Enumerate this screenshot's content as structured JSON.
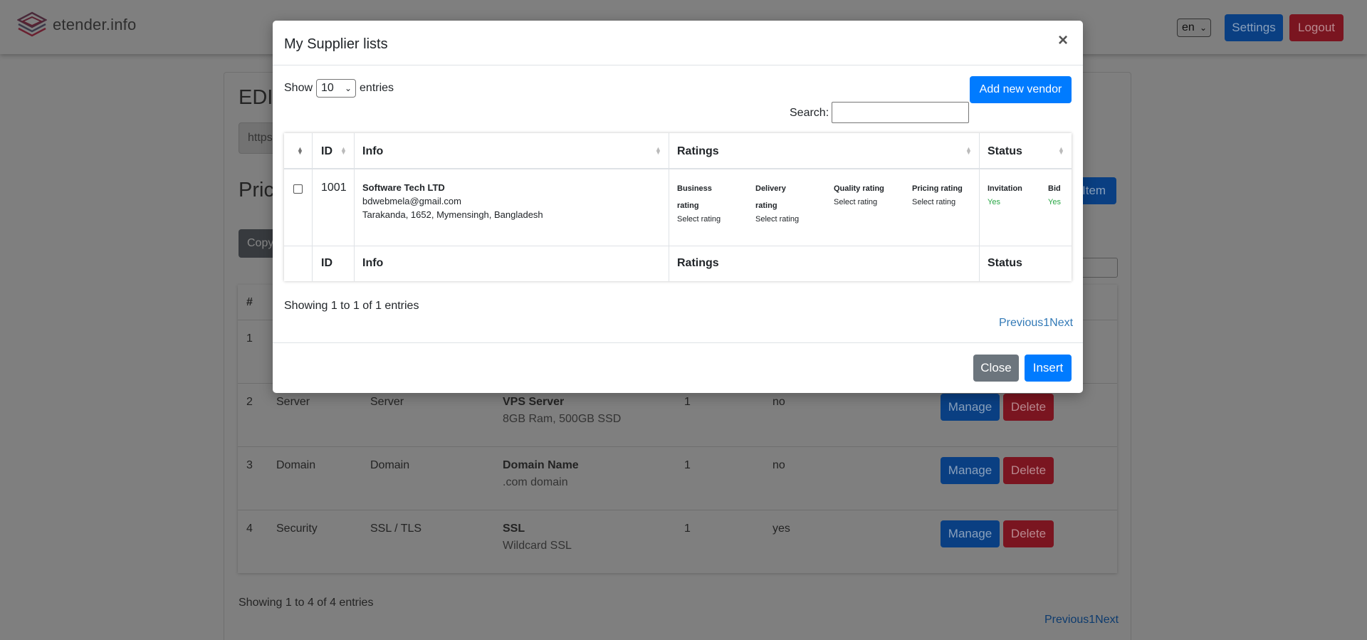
{
  "app": {
    "logo_text": "etender.info",
    "language": "en",
    "settings_label": "Settings",
    "logout_label": "Logout"
  },
  "background": {
    "heading_edit": "EDI",
    "url_prefix": "https",
    "heading_pricing": "Pric",
    "copy_label": "Copy",
    "add_item_label": "Item",
    "table_hash": "#",
    "rows": [
      {
        "num": "1",
        "category": "",
        "type": "",
        "name": "",
        "desc": "",
        "qty": "",
        "flag": ""
      },
      {
        "num": "2",
        "category": "Server",
        "type": "Server",
        "name": "VPS Server",
        "desc": "8GB Ram, 500GB SSD",
        "qty": "1",
        "flag": "no"
      },
      {
        "num": "3",
        "category": "Domain",
        "type": "Domain",
        "name": "Domain Name",
        "desc": ".com domain",
        "qty": "1",
        "flag": "no"
      },
      {
        "num": "4",
        "category": "Security",
        "type": "SSL / TLS",
        "name": "SSL",
        "desc": "Wildcard SSL",
        "qty": "1",
        "flag": "yes"
      }
    ],
    "manage_label": "Manage",
    "delete_label": "Delete",
    "showing_text": "Showing 1 to 4 of 4 entries",
    "pager": {
      "prev": "Previous",
      "page": "1",
      "next": "Next"
    }
  },
  "modal": {
    "title": "My Supplier lists",
    "close_symbol": "×",
    "show_label": "Show",
    "page_length": "10",
    "entries_label": "entries",
    "add_vendor_label": "Add new vendor",
    "search_label": "Search:",
    "search_value": "",
    "columns": {
      "id": "ID",
      "info": "Info",
      "ratings": "Ratings",
      "status": "Status"
    },
    "rows": [
      {
        "id": "1001",
        "name": "Software Tech LTD",
        "email": "bdwebmela@gmail.com",
        "address": "Tarakanda, 1652, Mymensingh, Bangladesh",
        "ratings": [
          {
            "label": "Business rating",
            "value": "Select rating"
          },
          {
            "label": "Delivery rating",
            "value": "Select rating"
          },
          {
            "label": "Quality rating",
            "value": "Select rating"
          },
          {
            "label": "Pricing rating",
            "value": "Select rating"
          }
        ],
        "status": {
          "invitation_label": "Invitation",
          "invitation_value": "Yes",
          "bid_label": "Bid",
          "bid_value": "Yes"
        }
      }
    ],
    "showing_text": "Showing 1 to 1 of 1 entries",
    "pager": {
      "prev": "Previous",
      "page": "1",
      "next": "Next"
    },
    "close_label": "Close",
    "insert_label": "Insert"
  },
  "colors": {
    "primary": "#007bff",
    "secondary": "#6c757d",
    "danger": "#dc3545",
    "success": "#28a745",
    "link": "#337ab7"
  }
}
